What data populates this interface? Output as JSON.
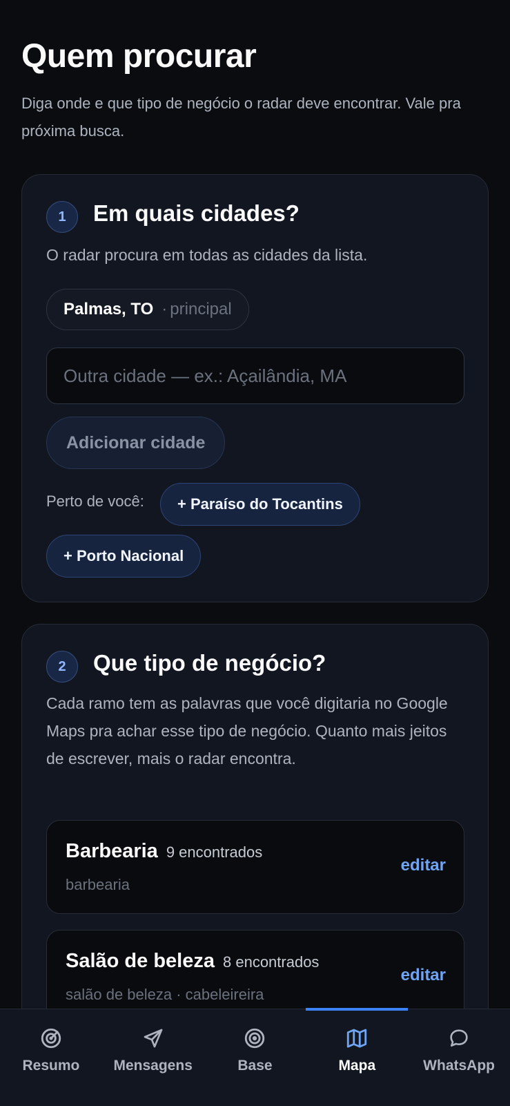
{
  "page": {
    "title": "Quem procurar",
    "subtitle": "Diga onde e que tipo de negócio o radar deve encontrar. Vale pra próxima busca."
  },
  "cities_section": {
    "step": "1",
    "title": "Em quais cidades?",
    "description": "O radar procura em todas as cidades da lista.",
    "cities": [
      {
        "name": "Palmas, TO",
        "separator": "·",
        "tag": "principal"
      }
    ],
    "input_placeholder": "Outra cidade — ex.: Açailândia, MA",
    "input_value": "",
    "add_button": "Adicionar cidade",
    "nearby_label": "Perto de você:",
    "nearby": [
      "+ Paraíso do Tocantins",
      "+ Porto Nacional"
    ]
  },
  "business_section": {
    "step": "2",
    "title": "Que tipo de negócio?",
    "description": "Cada ramo tem as palavras que você digitaria no Google Maps pra achar esse tipo de negócio. Quanto mais jeitos de escrever, mais o radar encontra.",
    "types": [
      {
        "name": "Barbearia",
        "count": "9 encontrados",
        "terms": "barbearia",
        "edit": "editar"
      },
      {
        "name": "Salão de beleza",
        "count": "8 encontrados",
        "terms": "salão de beleza · cabeleireira",
        "edit": "editar"
      }
    ]
  },
  "tabbar": {
    "active": "Mapa",
    "accent_color": "#3b82f6",
    "tabs": [
      {
        "label": "Resumo",
        "icon": "radar-icon"
      },
      {
        "label": "Mensagens",
        "icon": "send-icon"
      },
      {
        "label": "Base",
        "icon": "target-icon"
      },
      {
        "label": "Mapa",
        "icon": "map-icon"
      },
      {
        "label": "WhatsApp",
        "icon": "chat-bubble-icon"
      }
    ]
  }
}
